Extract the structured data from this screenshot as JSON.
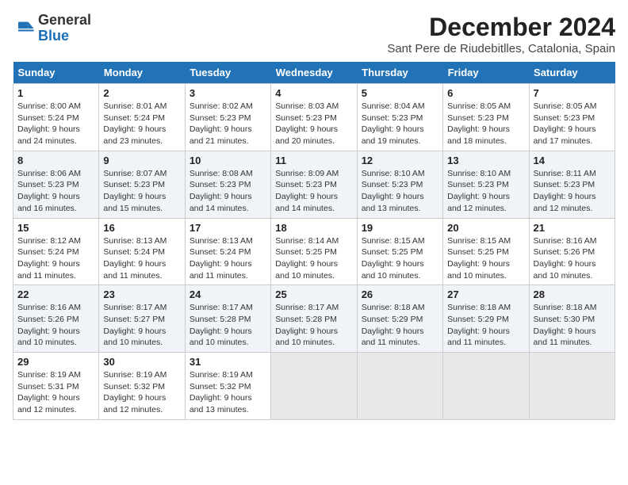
{
  "header": {
    "logo_line1": "General",
    "logo_line2": "Blue",
    "title": "December 2024",
    "subtitle": "Sant Pere de Riudebitlles, Catalonia, Spain"
  },
  "calendar": {
    "columns": [
      "Sunday",
      "Monday",
      "Tuesday",
      "Wednesday",
      "Thursday",
      "Friday",
      "Saturday"
    ],
    "weeks": [
      [
        {
          "day": "",
          "empty": true
        },
        {
          "day": "",
          "empty": true
        },
        {
          "day": "",
          "empty": true
        },
        {
          "day": "",
          "empty": true
        },
        {
          "day": "",
          "empty": true
        },
        {
          "day": "",
          "empty": true
        },
        {
          "day": "",
          "empty": true
        }
      ],
      [
        {
          "day": "1",
          "sunrise": "8:00 AM",
          "sunset": "5:24 PM",
          "daylight": "9 hours and 24 minutes."
        },
        {
          "day": "2",
          "sunrise": "8:01 AM",
          "sunset": "5:24 PM",
          "daylight": "9 hours and 23 minutes."
        },
        {
          "day": "3",
          "sunrise": "8:02 AM",
          "sunset": "5:23 PM",
          "daylight": "9 hours and 21 minutes."
        },
        {
          "day": "4",
          "sunrise": "8:03 AM",
          "sunset": "5:23 PM",
          "daylight": "9 hours and 20 minutes."
        },
        {
          "day": "5",
          "sunrise": "8:04 AM",
          "sunset": "5:23 PM",
          "daylight": "9 hours and 19 minutes."
        },
        {
          "day": "6",
          "sunrise": "8:05 AM",
          "sunset": "5:23 PM",
          "daylight": "9 hours and 18 minutes."
        },
        {
          "day": "7",
          "sunrise": "8:05 AM",
          "sunset": "5:23 PM",
          "daylight": "9 hours and 17 minutes."
        }
      ],
      [
        {
          "day": "8",
          "sunrise": "8:06 AM",
          "sunset": "5:23 PM",
          "daylight": "9 hours and 16 minutes."
        },
        {
          "day": "9",
          "sunrise": "8:07 AM",
          "sunset": "5:23 PM",
          "daylight": "9 hours and 15 minutes."
        },
        {
          "day": "10",
          "sunrise": "8:08 AM",
          "sunset": "5:23 PM",
          "daylight": "9 hours and 14 minutes."
        },
        {
          "day": "11",
          "sunrise": "8:09 AM",
          "sunset": "5:23 PM",
          "daylight": "9 hours and 14 minutes."
        },
        {
          "day": "12",
          "sunrise": "8:10 AM",
          "sunset": "5:23 PM",
          "daylight": "9 hours and 13 minutes."
        },
        {
          "day": "13",
          "sunrise": "8:10 AM",
          "sunset": "5:23 PM",
          "daylight": "9 hours and 12 minutes."
        },
        {
          "day": "14",
          "sunrise": "8:11 AM",
          "sunset": "5:23 PM",
          "daylight": "9 hours and 12 minutes."
        }
      ],
      [
        {
          "day": "15",
          "sunrise": "8:12 AM",
          "sunset": "5:24 PM",
          "daylight": "9 hours and 11 minutes."
        },
        {
          "day": "16",
          "sunrise": "8:13 AM",
          "sunset": "5:24 PM",
          "daylight": "9 hours and 11 minutes."
        },
        {
          "day": "17",
          "sunrise": "8:13 AM",
          "sunset": "5:24 PM",
          "daylight": "9 hours and 11 minutes."
        },
        {
          "day": "18",
          "sunrise": "8:14 AM",
          "sunset": "5:25 PM",
          "daylight": "9 hours and 10 minutes."
        },
        {
          "day": "19",
          "sunrise": "8:15 AM",
          "sunset": "5:25 PM",
          "daylight": "9 hours and 10 minutes."
        },
        {
          "day": "20",
          "sunrise": "8:15 AM",
          "sunset": "5:25 PM",
          "daylight": "9 hours and 10 minutes."
        },
        {
          "day": "21",
          "sunrise": "8:16 AM",
          "sunset": "5:26 PM",
          "daylight": "9 hours and 10 minutes."
        }
      ],
      [
        {
          "day": "22",
          "sunrise": "8:16 AM",
          "sunset": "5:26 PM",
          "daylight": "9 hours and 10 minutes."
        },
        {
          "day": "23",
          "sunrise": "8:17 AM",
          "sunset": "5:27 PM",
          "daylight": "9 hours and 10 minutes."
        },
        {
          "day": "24",
          "sunrise": "8:17 AM",
          "sunset": "5:28 PM",
          "daylight": "9 hours and 10 minutes."
        },
        {
          "day": "25",
          "sunrise": "8:17 AM",
          "sunset": "5:28 PM",
          "daylight": "9 hours and 10 minutes."
        },
        {
          "day": "26",
          "sunrise": "8:18 AM",
          "sunset": "5:29 PM",
          "daylight": "9 hours and 11 minutes."
        },
        {
          "day": "27",
          "sunrise": "8:18 AM",
          "sunset": "5:29 PM",
          "daylight": "9 hours and 11 minutes."
        },
        {
          "day": "28",
          "sunrise": "8:18 AM",
          "sunset": "5:30 PM",
          "daylight": "9 hours and 11 minutes."
        }
      ],
      [
        {
          "day": "29",
          "sunrise": "8:19 AM",
          "sunset": "5:31 PM",
          "daylight": "9 hours and 12 minutes."
        },
        {
          "day": "30",
          "sunrise": "8:19 AM",
          "sunset": "5:32 PM",
          "daylight": "9 hours and 12 minutes."
        },
        {
          "day": "31",
          "sunrise": "8:19 AM",
          "sunset": "5:32 PM",
          "daylight": "9 hours and 13 minutes."
        },
        {
          "day": "",
          "empty": true
        },
        {
          "day": "",
          "empty": true
        },
        {
          "day": "",
          "empty": true
        },
        {
          "day": "",
          "empty": true
        }
      ]
    ]
  }
}
